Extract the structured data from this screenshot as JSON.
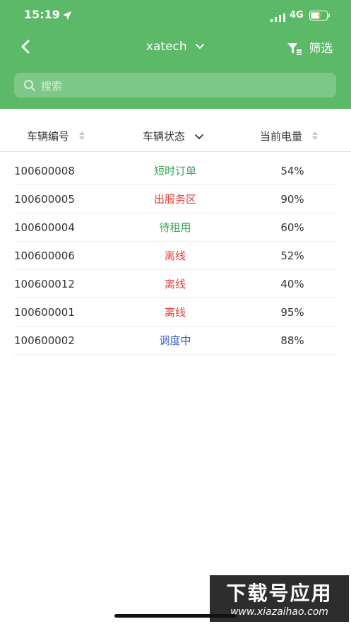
{
  "status_bar": {
    "time": "15:19",
    "network": "4G"
  },
  "nav": {
    "title": "xatech",
    "filter_label": "筛选"
  },
  "search": {
    "placeholder": "搜索"
  },
  "table": {
    "headers": [
      "车辆编号",
      "车辆状态",
      "当前电量"
    ],
    "rows": [
      {
        "id": "100600008",
        "status": "短时订单",
        "battery": "54%",
        "status_color": "#3aa35a"
      },
      {
        "id": "100600005",
        "status": "出服务区",
        "battery": "90%",
        "status_color": "#e0403a"
      },
      {
        "id": "100600004",
        "status": "待租用",
        "battery": "60%",
        "status_color": "#3aa35a"
      },
      {
        "id": "100600006",
        "status": "离线",
        "battery": "52%",
        "status_color": "#e0403a"
      },
      {
        "id": "100600012",
        "status": "离线",
        "battery": "40%",
        "status_color": "#e0403a"
      },
      {
        "id": "100600001",
        "status": "离线",
        "battery": "95%",
        "status_color": "#e0403a"
      },
      {
        "id": "100600002",
        "status": "调度中",
        "battery": "88%",
        "status_color": "#3a62c9"
      }
    ]
  },
  "watermark": {
    "line1": "下载号应用",
    "line2": "www.xiazaihao.com"
  }
}
